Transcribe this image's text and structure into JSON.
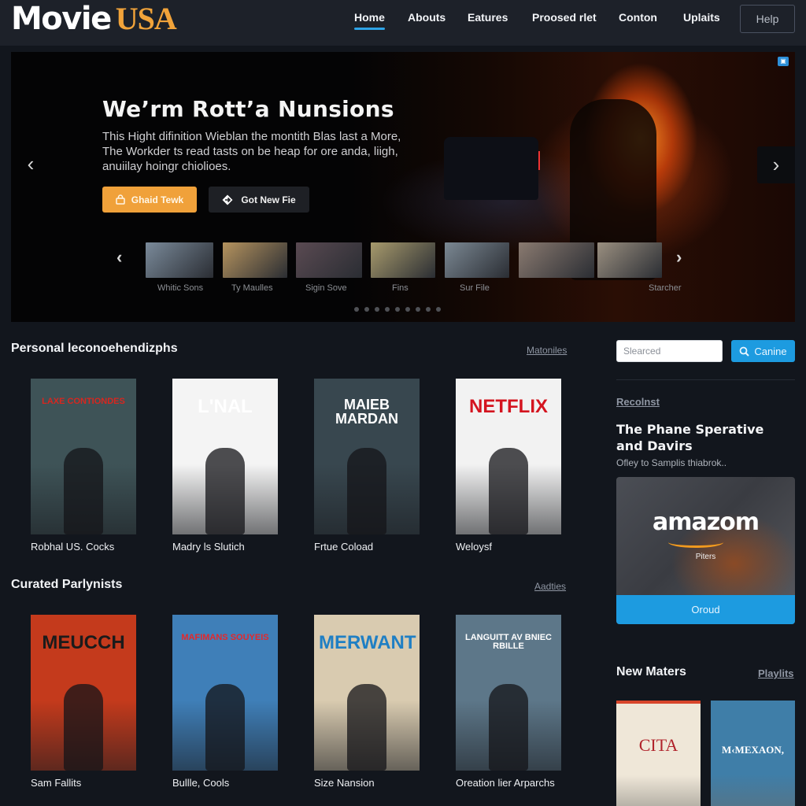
{
  "brand": {
    "name_part1": "Movie",
    "name_part2": "USA"
  },
  "nav": {
    "items": [
      {
        "label": "Home",
        "active": true
      },
      {
        "label": "Abouts",
        "active": false
      },
      {
        "label": "Eatures",
        "active": false
      },
      {
        "label": "Proosed rlet",
        "active": false
      },
      {
        "label": "Conton",
        "active": false
      },
      {
        "label": "Uplaits",
        "active": false
      }
    ],
    "help_label": "Help"
  },
  "hero": {
    "title": "We’rm Rott’a Nunsions",
    "description": "This Hight difinition Wieblan the montith Blas last a More, The Workder ts read tasts on be heap for ore anda, liigh, anuiilay hoingr chiolioes.",
    "primary_button": {
      "label": "Ghaid Tewk",
      "icon": "lock-icon"
    },
    "secondary_button": {
      "label": "Got New Fie",
      "icon": "diamond-arrow-icon"
    },
    "prev_icon": "‹",
    "next_icon": "›",
    "badge_icon": "▣",
    "thumbnails": [
      {
        "label": "Whitic Sons",
        "color": "#7a8a9a"
      },
      {
        "label": "Ty Maulles",
        "color": "#b5935e"
      },
      {
        "label": "Sigin Sove",
        "color": "#5a4a52"
      },
      {
        "label": "Fins",
        "color": "#a79a6c"
      },
      {
        "label": "Sur File",
        "color": "#7b8893"
      },
      {
        "label": "",
        "color": "#8a7a70"
      },
      {
        "label": "Starcher",
        "color": "#9a8f80"
      }
    ],
    "thumb_prev": "‹",
    "thumb_next": "›",
    "dots_count": 9,
    "active_dot": 0
  },
  "sections": {
    "personal": {
      "title": "Personal leconoehendizphs",
      "link": "Matoniles",
      "movies": [
        {
          "label": "Robhal US. Cocks",
          "poster_text": "LAXE CONTIONDES",
          "bg": "#3e5357",
          "text_color": "#d8261f"
        },
        {
          "label": "Madry ls Slutich",
          "poster_text": "L'NAL",
          "bg": "#f4f4f4",
          "text_color": "#ffffff"
        },
        {
          "label": "Frtue Coload",
          "poster_text": "MAIEB MARDAN",
          "bg": "#38474f",
          "text_color": "#ffffff"
        },
        {
          "label": "Weloysf",
          "poster_text": "NETFLIX",
          "bg": "#f2f2f2",
          "text_color": "#d4141f"
        }
      ]
    },
    "curated": {
      "title": "Curated Parlynists",
      "link": "Aadties",
      "movies": [
        {
          "label": "Sam Fallits",
          "poster_text": "MEUCCH",
          "bg": "#c43a1c",
          "text_color": "#1b1b1b"
        },
        {
          "label": "Bullle, Cools",
          "poster_text": "MAFIMANS SOUYEIS",
          "bg": "#3f7fb8",
          "text_color": "#e4282b"
        },
        {
          "label": "Size Nansion",
          "poster_text": "MERWANT",
          "bg": "#d9cbb0",
          "text_color": "#1f7fc4"
        },
        {
          "label": "Oreation lier Arparchs",
          "poster_text": "LANGUITT AV BNIEC RBILLE",
          "bg": "#5d7789",
          "text_color": "#ffffff"
        }
      ]
    }
  },
  "sidebar": {
    "search": {
      "placeholder": "Slearced",
      "value": "",
      "button_label": "Canine",
      "button_icon": "search-icon"
    },
    "recent_label": "Recolnst",
    "feature_title": "The Phane Sperative and Davirs",
    "feature_subtitle": "Ofley to Samplis thiabrok..",
    "promo": {
      "logo_text": "amazom",
      "subtitle": "Piters",
      "button_label": "Oroud"
    },
    "new_section": {
      "title": "New Maters",
      "link": "Playlits",
      "posters": [
        {
          "poster_text": "CITA",
          "bg": "#efe7d8",
          "text_color": "#b0232b"
        },
        {
          "poster_text": "M‹MEXAON,",
          "bg": "#3f7ea8",
          "text_color": "#ffffff"
        }
      ]
    }
  },
  "colors": {
    "accent_blue": "#1d9be0",
    "accent_orange": "#f0a13a",
    "background": "#12161d",
    "header": "#1d2129"
  }
}
